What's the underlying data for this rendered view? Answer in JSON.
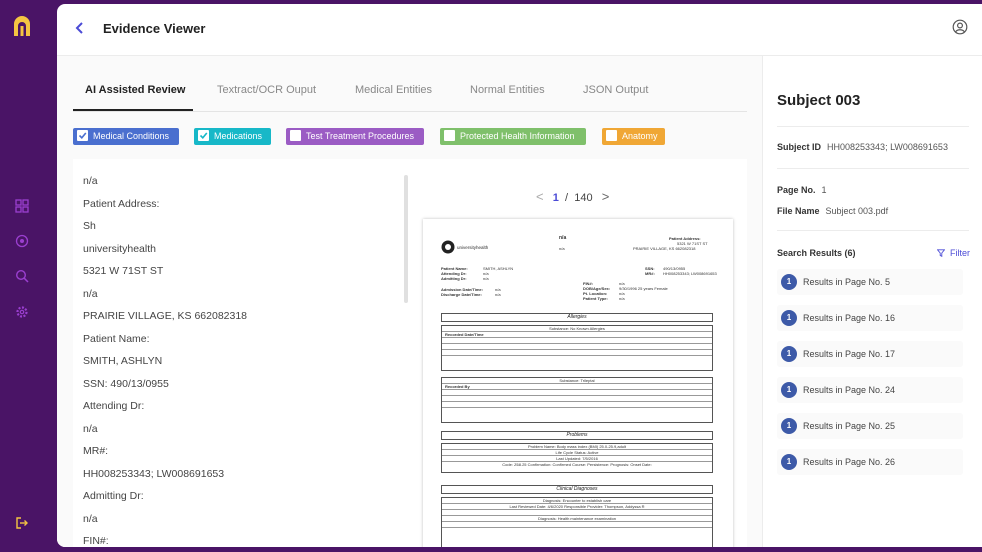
{
  "app": {
    "title": "Evidence Viewer"
  },
  "tabs": [
    "AI Assisted Review",
    "Textract/OCR Ouput",
    "Medical Entities",
    "Normal Entities",
    "JSON Output"
  ],
  "filters": [
    {
      "label": "Medical Conditions",
      "color": "#4a6fcf",
      "checked": true
    },
    {
      "label": "Medications",
      "color": "#17b8c8",
      "checked": true
    },
    {
      "label": "Test Treatment Procedures",
      "color": "#9b5cc4",
      "checked": false
    },
    {
      "label": "Protected Health Information",
      "color": "#7fc06b",
      "checked": false
    },
    {
      "label": "Anatomy",
      "color": "#f0a735",
      "checked": false
    }
  ],
  "extracted_text": [
    "n/a",
    "Patient Address:",
    "Sh",
    "universityhealth",
    "5321 W 71ST ST",
    "n/a",
    "PRAIRIE VILLAGE, KS 662082318",
    "Patient Name:",
    "SMITH, ASHLYN",
    "SSN: 490/13/0955",
    "Attending Dr:",
    "n/a",
    "MR#:",
    "HH008253343; LW008691653",
    "Admitting Dr:",
    "n/a",
    "FIN#:"
  ],
  "pager": {
    "current": "1",
    "separator": "/",
    "total": "140",
    "prev": "<",
    "next": ">"
  },
  "document": {
    "logo_text": "universityhealth",
    "na": "n/a",
    "address_label": "Patient Address:",
    "address_lines": [
      "5321 W 71ST ST",
      "PRAIRIE VILLAGE, KS 662082318"
    ],
    "left_labels": [
      "Patient Name:",
      "Attending Dr:",
      "Admitting Dr:",
      "",
      "Admission Date/Time:",
      "Discharge Date/Time:"
    ],
    "left_values": [
      "SMITH, ASHLYN",
      "n/a",
      "n/a",
      "",
      "n/a",
      "n/a"
    ],
    "right_labels": [
      "SSN:",
      "MR#:"
    ],
    "right_values": [
      "490/13/0955",
      "HH008253343; LW008691653"
    ],
    "mid_labels": [
      "FIN#:",
      "DOB/Age/Sex:",
      "Pt. Location:",
      "Patient Type:"
    ],
    "mid_values": [
      "n/a",
      "9/30/1996  25 years  Female",
      "n/a",
      "n/a"
    ],
    "sections": [
      "Allergies",
      "Problems",
      "Clinical Diagnoses"
    ],
    "allergy_headers": [
      "Recorded Date/Time",
      "Recorded By"
    ],
    "allergy_rows": [
      "Substance: No Known Allergies",
      "Substance: Trileptal"
    ],
    "problem_rows": [
      "Problem Name: Body mass index (BMI) 25.0-25.9,adult",
      "Life Cycle Status: Active",
      "Last Updated: 7/5/2016",
      "Code: Z68.25  Confirmation: Confirmed  Course:  Persistence:  Prognosis:  Onset Date:"
    ],
    "diagnosis_rows": [
      "Diagnosis: Encounter to establish care",
      "Last Reviewed Date: 4/6/2020   Responsible Provider: Thompson, Addyssa R",
      "Diagnosis: Health maintenance examination"
    ]
  },
  "subject": {
    "name": "Subject 003",
    "id_label": "Subject ID",
    "id_value": "HH008253343; LW008691653",
    "page_label": "Page No.",
    "page_value": "1",
    "file_label": "File Name",
    "file_value": "Subject 003.pdf"
  },
  "search": {
    "title": "Search Results (6)",
    "filter_label": "Filter",
    "results": [
      {
        "count": "1",
        "label": "Results in Page No. 5"
      },
      {
        "count": "1",
        "label": "Results in Page No. 16"
      },
      {
        "count": "1",
        "label": "Results in Page No. 17"
      },
      {
        "count": "1",
        "label": "Results in Page No. 24"
      },
      {
        "count": "1",
        "label": "Results in Page No. 25"
      },
      {
        "count": "1",
        "label": "Results in Page No. 26"
      }
    ]
  }
}
